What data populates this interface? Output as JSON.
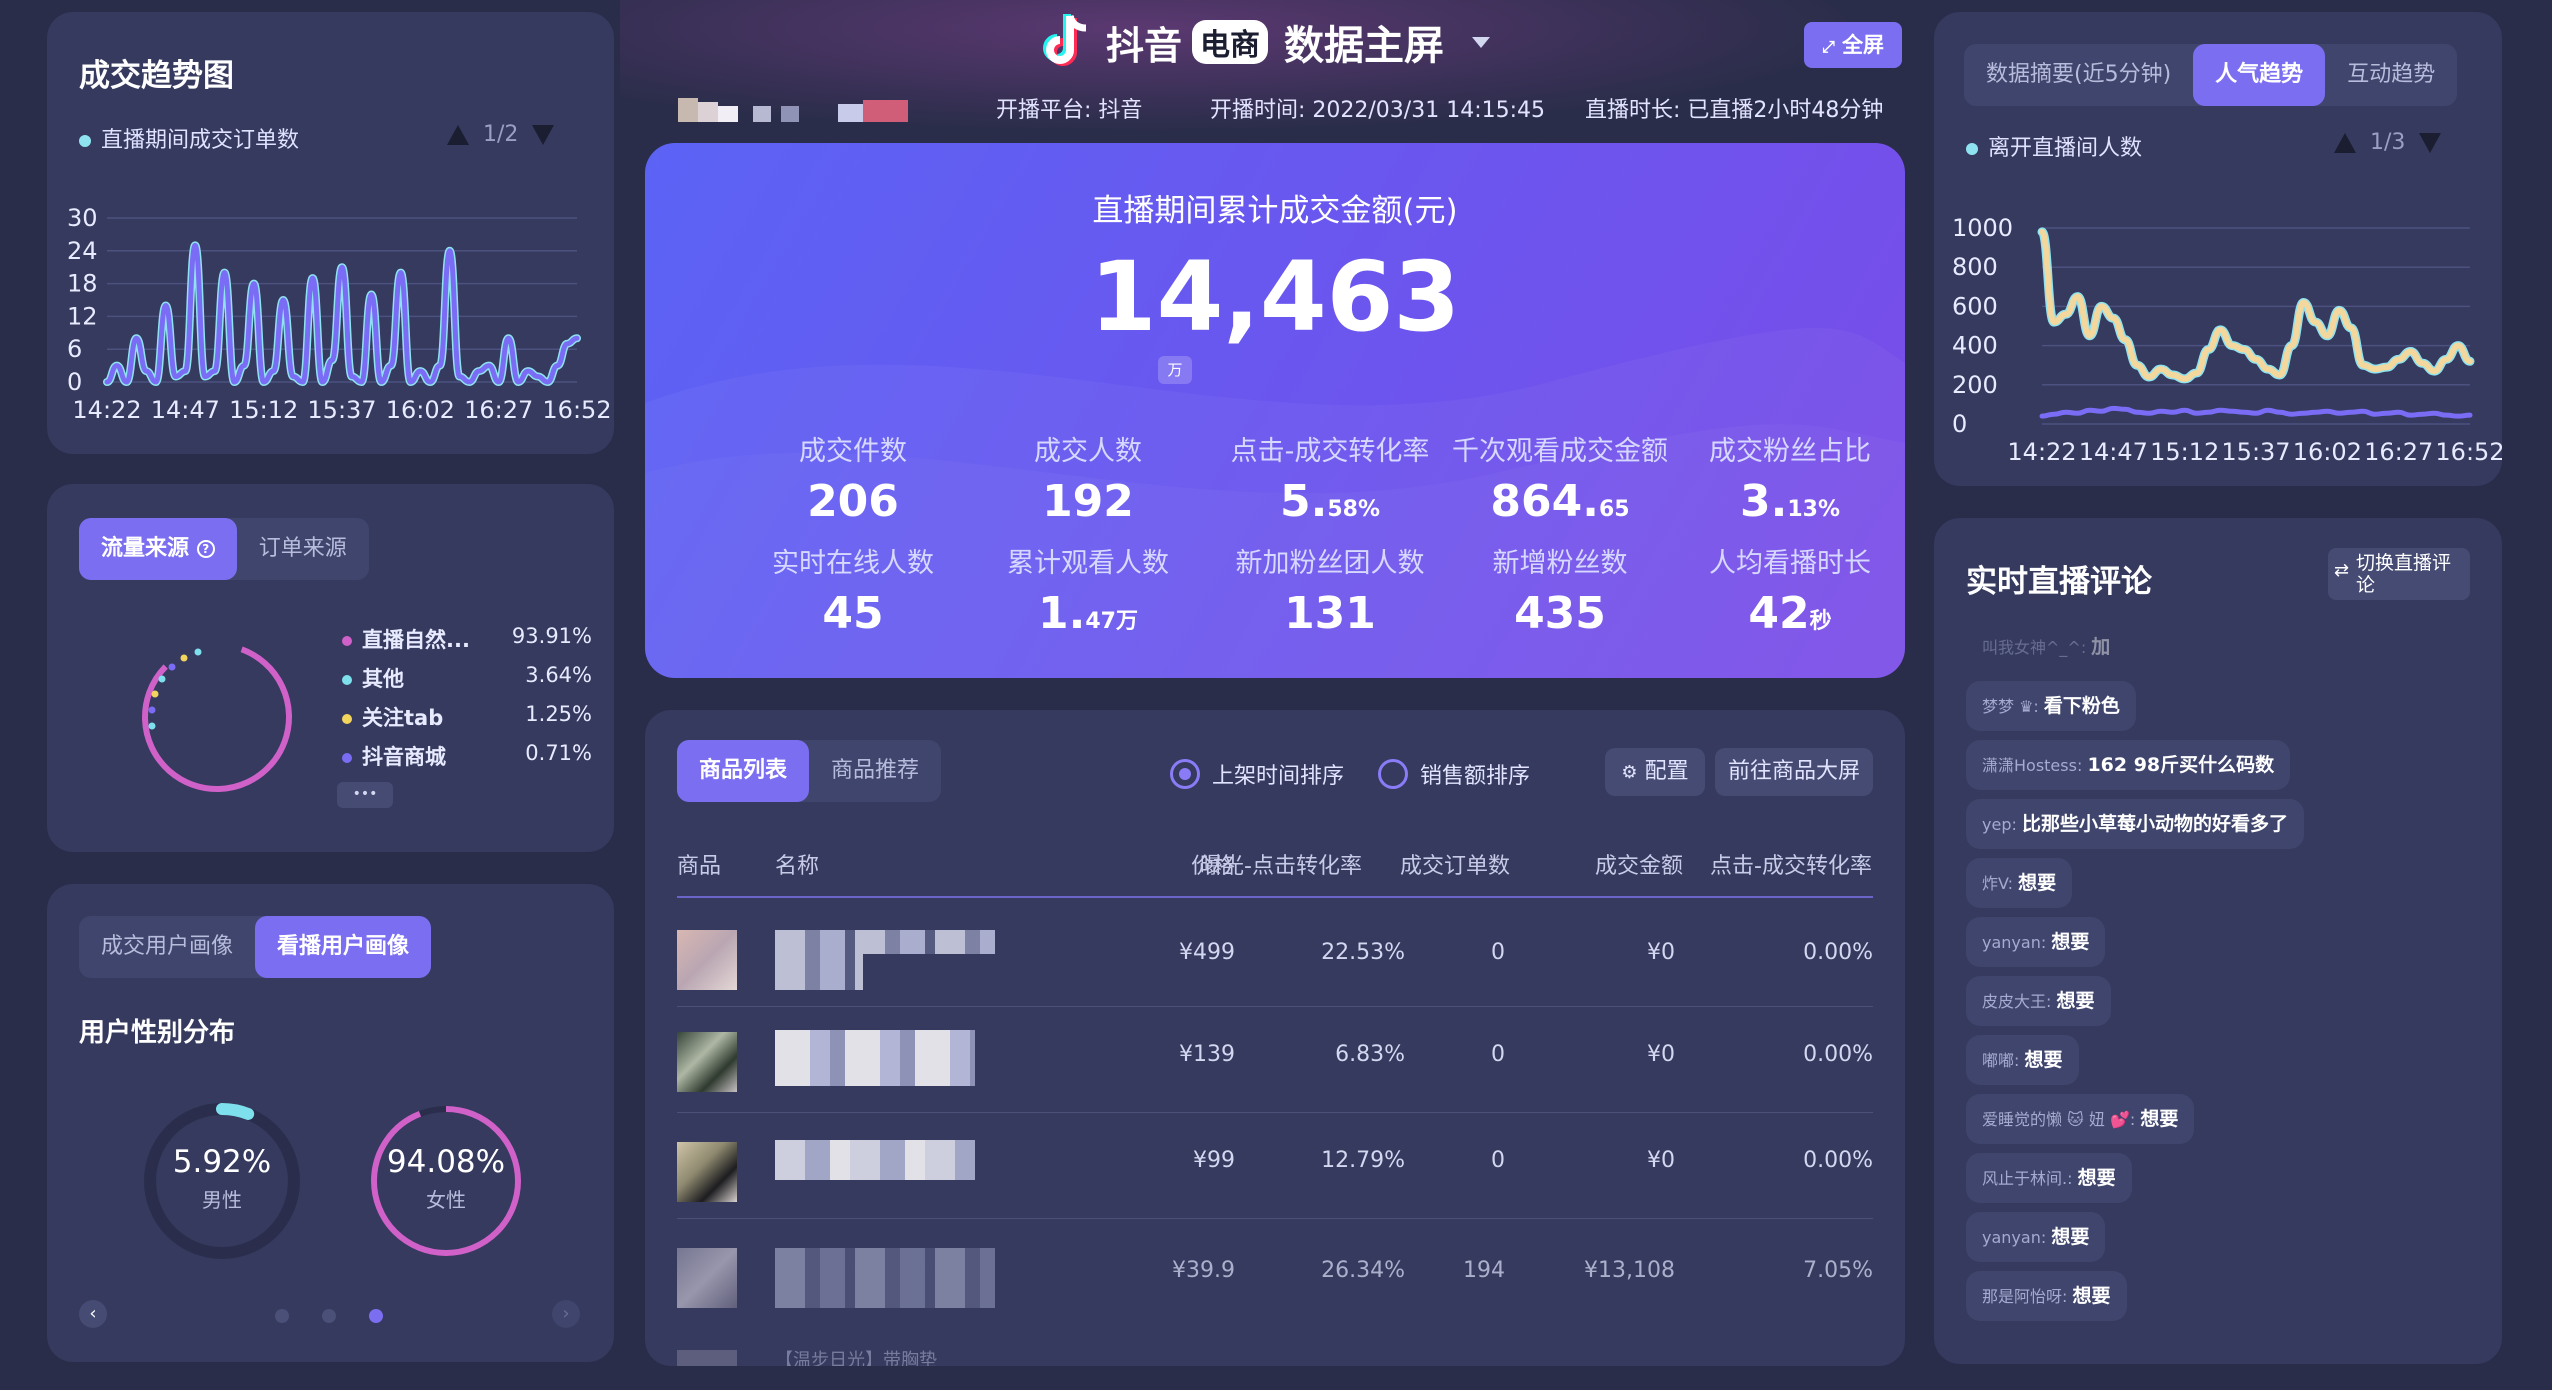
{
  "header": {
    "logo_text": "抖音",
    "badge": "电商",
    "title": "数据主屏",
    "fullscreen_label": "全屏",
    "platform": "开播平台: 抖音",
    "start_time": "开播时间: 2022/03/31 14:15:45",
    "duration": "直播时长: 已直播2小时48分钟"
  },
  "trend": {
    "title": "成交趋势图",
    "legend": "直播期间成交订单数",
    "pager": "1/2",
    "yticks": [
      "30",
      "24",
      "18",
      "12",
      "6",
      "0"
    ],
    "xticks": [
      "14:22",
      "14:47",
      "15:12",
      "15:37",
      "16:02",
      "16:27",
      "16:52"
    ],
    "colors": {
      "line": "#7a6cf5",
      "highlight": "#8fe3f0"
    }
  },
  "chart_data": [
    {
      "type": "line",
      "title": "成交趋势图",
      "series": [
        {
          "name": "直播期间成交订单数",
          "values": [
            0,
            3,
            0,
            8,
            2,
            0,
            14,
            1,
            2,
            25,
            1,
            2,
            20,
            0,
            3,
            18,
            0,
            2,
            15,
            1,
            0,
            19,
            0,
            4,
            21,
            1,
            0,
            16,
            0,
            3,
            20,
            0,
            2,
            0,
            3,
            24,
            1,
            0,
            2,
            3,
            0,
            8,
            0,
            2,
            1,
            0,
            3,
            7,
            8
          ]
        }
      ],
      "x": [
        "14:22",
        "14:47",
        "15:12",
        "15:37",
        "16:02",
        "16:27",
        "16:52"
      ],
      "ylim": [
        0,
        30
      ],
      "grid": true
    },
    {
      "type": "line",
      "title": "离开直播间人数",
      "series": [
        {
          "name": "离开直播间人数",
          "values": [
            980,
            520,
            560,
            650,
            450,
            600,
            540,
            430,
            300,
            240,
            280,
            250,
            230,
            260,
            380,
            480,
            400,
            380,
            330,
            280,
            250,
            400,
            620,
            520,
            450,
            580,
            490,
            300,
            280,
            290,
            330,
            370,
            310,
            270,
            330,
            400,
            320
          ]
        },
        {
          "name": "",
          "values": [
            40,
            50,
            60,
            55,
            70,
            65,
            80,
            75,
            60,
            55,
            65,
            60,
            70,
            55,
            60,
            70,
            65,
            60,
            55,
            70,
            60,
            50,
            55,
            60,
            65,
            55,
            60,
            65,
            50,
            55,
            60,
            45,
            50,
            55,
            45,
            40,
            45
          ]
        }
      ],
      "x": [
        "14:22",
        "14:47",
        "15:12",
        "15:37",
        "16:02",
        "16:27",
        "16:52"
      ],
      "ylim": [
        0,
        1000
      ],
      "grid": true
    }
  ],
  "traffic": {
    "tabs": [
      "流量来源",
      "订单来源"
    ],
    "items": [
      {
        "label": "直播自然...",
        "value": "93.91%",
        "color": "#d061c9"
      },
      {
        "label": "其他",
        "value": "3.64%",
        "color": "#7ee0ec"
      },
      {
        "label": "关注tab",
        "value": "1.25%",
        "color": "#f2d55c"
      },
      {
        "label": "抖音商城",
        "value": "0.71%",
        "color": "#7a6cf5"
      }
    ],
    "more": "•••"
  },
  "users": {
    "tabs": [
      "成交用户画像",
      "看播用户画像"
    ],
    "subtitle": "用户性别分布",
    "male": {
      "pct": "5.92%",
      "label": "男性",
      "value": 0.0592
    },
    "female": {
      "pct": "94.08%",
      "label": "女性",
      "value": 0.9408
    }
  },
  "hero": {
    "title": "直播期间累计成交金额(元)",
    "amount": "14,463",
    "unit": "万",
    "kpis": [
      {
        "label": "成交件数",
        "value": "206",
        "unit": ""
      },
      {
        "label": "成交人数",
        "value": "192",
        "unit": ""
      },
      {
        "label": "点击-成交转化率",
        "value": "5.",
        "unit": "58%"
      },
      {
        "label": "千次观看成交金额",
        "value": "864.",
        "unit": "65"
      },
      {
        "label": "成交粉丝占比",
        "value": "3.",
        "unit": "13%"
      },
      {
        "label": "实时在线人数",
        "value": "45",
        "unit": ""
      },
      {
        "label": "累计观看人数",
        "value": "1.",
        "unit": "47万"
      },
      {
        "label": "新加粉丝团人数",
        "value": "131",
        "unit": ""
      },
      {
        "label": "新增粉丝数",
        "value": "435",
        "unit": ""
      },
      {
        "label": "人均看播时长",
        "value": "42",
        "unit": "秒"
      }
    ]
  },
  "products": {
    "tabs": [
      "商品列表",
      "商品推荐"
    ],
    "sort1": "上架时间排序",
    "sort2": "销售额排序",
    "config": "配置",
    "goto": "前往商品大屏",
    "headers": [
      "商品",
      "名称",
      "价格",
      "曝光-点击转化率",
      "成交订单数",
      "成交金额",
      "点击-成交转化率"
    ],
    "rows": [
      {
        "price": "¥499",
        "ctr": "22.53%",
        "orders": "0",
        "gmv": "¥0",
        "cvr": "0.00%"
      },
      {
        "price": "¥139",
        "ctr": "6.83%",
        "orders": "0",
        "gmv": "¥0",
        "cvr": "0.00%"
      },
      {
        "price": "¥99",
        "ctr": "12.79%",
        "orders": "0",
        "gmv": "¥0",
        "cvr": "0.00%"
      },
      {
        "price": "¥39.9",
        "ctr": "26.34%",
        "orders": "194",
        "gmv": "¥13,108",
        "cvr": "7.05%"
      }
    ],
    "partial_row": "【温步日光】带胸垫"
  },
  "right": {
    "tabs": [
      "数据摘要(近5分钟)",
      "人气趋势",
      "互动趋势"
    ],
    "legend": "离开直播间人数",
    "pager": "1/3",
    "yticks": [
      "1000",
      "800",
      "600",
      "400",
      "200",
      "0"
    ],
    "xticks": [
      "14:22",
      "14:47",
      "15:12",
      "15:37",
      "16:02",
      "16:27",
      "16:52"
    ]
  },
  "comments": {
    "title": "实时直播评论",
    "switch_label": "切换直播评论",
    "items": [
      {
        "nick": "叫我女神^_^:",
        "msg": "加"
      },
      {
        "nick": "梦梦 ♛:",
        "msg": "看下粉色"
      },
      {
        "nick": "潇潇Hostess:",
        "msg": "162 98斤买什么码数"
      },
      {
        "nick": "yep:",
        "msg": "比那些小草莓小动物的好看多了"
      },
      {
        "nick": "炸V:",
        "msg": "想要"
      },
      {
        "nick": "yanyan:",
        "msg": "想要"
      },
      {
        "nick": "皮皮大王:",
        "msg": "想要"
      },
      {
        "nick": "嘟嘟:",
        "msg": "想要"
      },
      {
        "nick": "爱睡觉的懒 🐱 妞 💕:",
        "msg": "想要"
      },
      {
        "nick": "风止于林间.:",
        "msg": "想要"
      },
      {
        "nick": "yanyan:",
        "msg": "想要"
      },
      {
        "nick": "那是阿怡呀:",
        "msg": "想要"
      }
    ]
  }
}
